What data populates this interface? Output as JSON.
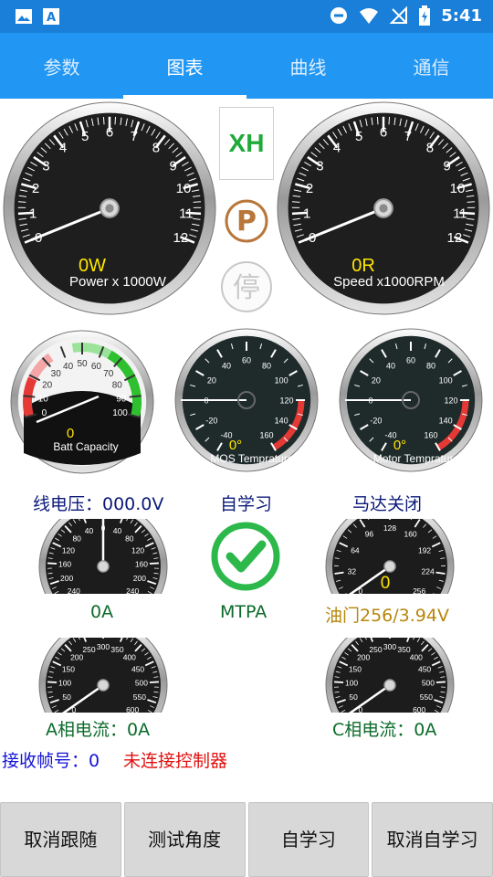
{
  "status_bar": {
    "time": "5:41",
    "icons": [
      "image-icon",
      "text-icon",
      "dnd-icon",
      "wifi-icon",
      "no-signal-icon",
      "battery-icon"
    ]
  },
  "tabs": [
    {
      "label": "参数",
      "active": false
    },
    {
      "label": "图表",
      "active": true
    },
    {
      "label": "曲线",
      "active": false
    },
    {
      "label": "通信",
      "active": false
    }
  ],
  "center_panel": {
    "xh_label": "XH",
    "parking_symbol": "P",
    "stop_label": "停"
  },
  "gauges": {
    "power": {
      "value_text": "0W",
      "caption": "Power x 1000W",
      "ticks": [
        "0",
        "1",
        "2",
        "3",
        "4",
        "5",
        "6",
        "7",
        "8",
        "9",
        "10",
        "11",
        "12"
      ],
      "value": 0
    },
    "speed": {
      "value_text": "0R",
      "caption": "Speed x1000RPM",
      "ticks": [
        "0",
        "1",
        "2",
        "3",
        "4",
        "5",
        "6",
        "7",
        "8",
        "9",
        "10",
        "11",
        "12"
      ],
      "value": 0
    },
    "battery": {
      "value_text": "0",
      "caption": "Batt Capacity",
      "ticks": [
        "0",
        "10",
        "20",
        "30",
        "40",
        "50",
        "60",
        "70",
        "80",
        "90",
        "100"
      ],
      "value": 0
    },
    "mos_temp": {
      "value_text": "0°",
      "caption": "MOS Temprature",
      "ticks": [
        "-40",
        "-20",
        "0",
        "20",
        "40",
        "60",
        "80",
        "100",
        "120",
        "140",
        "160"
      ],
      "value": 0
    },
    "motor_temp": {
      "value_text": "0°",
      "caption": "Motor Temprature",
      "ticks": [
        "-40",
        "-20",
        "0",
        "20",
        "40",
        "60",
        "80",
        "100",
        "120",
        "140",
        "160"
      ],
      "value": 0
    },
    "current": {
      "ticks": [
        "240",
        "200",
        "160",
        "120",
        "80",
        "40",
        "0",
        "40",
        "80",
        "120",
        "160",
        "200",
        "240"
      ],
      "value": 0
    },
    "throttle": {
      "value_text": "0",
      "ticks": [
        "0",
        "32",
        "64",
        "96",
        "128",
        "160",
        "192",
        "224",
        "256"
      ],
      "value": 0
    },
    "phase_a": {
      "ticks": [
        "0",
        "50",
        "100",
        "150",
        "200",
        "250",
        "300",
        "350",
        "400",
        "450",
        "500",
        "550",
        "600"
      ],
      "value": 0
    },
    "phase_c": {
      "ticks": [
        "0",
        "50",
        "100",
        "150",
        "200",
        "250",
        "300",
        "350",
        "400",
        "450",
        "500",
        "550",
        "600"
      ],
      "value": 0
    }
  },
  "labels": {
    "line_voltage": "线电压：000.0V",
    "self_learn_status": "自学习",
    "motor_status": "马达关闭",
    "current_value": "0A",
    "mtpa": "MTPA",
    "throttle": "油门256/3.94V",
    "phase_a_current": "A相电流：0A",
    "phase_c_current": "C相电流：0A",
    "frame_number": "接收帧号：0",
    "connection_status": "未连接控制器"
  },
  "buttons": [
    {
      "label": "取消跟随"
    },
    {
      "label": "测试角度"
    },
    {
      "label": "自学习"
    },
    {
      "label": "取消自学习"
    }
  ],
  "colors": {
    "status_bar": "#1a7fd8",
    "tab_bar": "#2196f3",
    "gauge_value": "#ffe600",
    "check_green": "#2db84b",
    "parking_brown": "#b8763a"
  }
}
